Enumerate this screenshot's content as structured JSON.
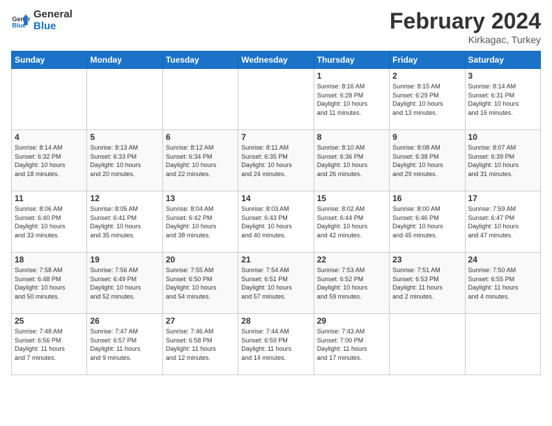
{
  "header": {
    "logo_general": "General",
    "logo_blue": "Blue",
    "month_year": "February 2024",
    "location": "Kirkagac, Turkey"
  },
  "days_of_week": [
    "Sunday",
    "Monday",
    "Tuesday",
    "Wednesday",
    "Thursday",
    "Friday",
    "Saturday"
  ],
  "weeks": [
    [
      {
        "day": "",
        "info": ""
      },
      {
        "day": "",
        "info": ""
      },
      {
        "day": "",
        "info": ""
      },
      {
        "day": "",
        "info": ""
      },
      {
        "day": "1",
        "info": "Sunrise: 8:16 AM\nSunset: 6:28 PM\nDaylight: 10 hours\nand 11 minutes."
      },
      {
        "day": "2",
        "info": "Sunrise: 8:15 AM\nSunset: 6:29 PM\nDaylight: 10 hours\nand 13 minutes."
      },
      {
        "day": "3",
        "info": "Sunrise: 8:14 AM\nSunset: 6:31 PM\nDaylight: 10 hours\nand 16 minutes."
      }
    ],
    [
      {
        "day": "4",
        "info": "Sunrise: 8:14 AM\nSunset: 6:32 PM\nDaylight: 10 hours\nand 18 minutes."
      },
      {
        "day": "5",
        "info": "Sunrise: 8:13 AM\nSunset: 6:33 PM\nDaylight: 10 hours\nand 20 minutes."
      },
      {
        "day": "6",
        "info": "Sunrise: 8:12 AM\nSunset: 6:34 PM\nDaylight: 10 hours\nand 22 minutes."
      },
      {
        "day": "7",
        "info": "Sunrise: 8:11 AM\nSunset: 6:35 PM\nDaylight: 10 hours\nand 24 minutes."
      },
      {
        "day": "8",
        "info": "Sunrise: 8:10 AM\nSunset: 6:36 PM\nDaylight: 10 hours\nand 26 minutes."
      },
      {
        "day": "9",
        "info": "Sunrise: 8:08 AM\nSunset: 6:38 PM\nDaylight: 10 hours\nand 29 minutes."
      },
      {
        "day": "10",
        "info": "Sunrise: 8:07 AM\nSunset: 6:39 PM\nDaylight: 10 hours\nand 31 minutes."
      }
    ],
    [
      {
        "day": "11",
        "info": "Sunrise: 8:06 AM\nSunset: 6:40 PM\nDaylight: 10 hours\nand 33 minutes."
      },
      {
        "day": "12",
        "info": "Sunrise: 8:05 AM\nSunset: 6:41 PM\nDaylight: 10 hours\nand 35 minutes."
      },
      {
        "day": "13",
        "info": "Sunrise: 8:04 AM\nSunset: 6:42 PM\nDaylight: 10 hours\nand 38 minutes."
      },
      {
        "day": "14",
        "info": "Sunrise: 8:03 AM\nSunset: 6:43 PM\nDaylight: 10 hours\nand 40 minutes."
      },
      {
        "day": "15",
        "info": "Sunrise: 8:02 AM\nSunset: 6:44 PM\nDaylight: 10 hours\nand 42 minutes."
      },
      {
        "day": "16",
        "info": "Sunrise: 8:00 AM\nSunset: 6:46 PM\nDaylight: 10 hours\nand 45 minutes."
      },
      {
        "day": "17",
        "info": "Sunrise: 7:59 AM\nSunset: 6:47 PM\nDaylight: 10 hours\nand 47 minutes."
      }
    ],
    [
      {
        "day": "18",
        "info": "Sunrise: 7:58 AM\nSunset: 6:48 PM\nDaylight: 10 hours\nand 50 minutes."
      },
      {
        "day": "19",
        "info": "Sunrise: 7:56 AM\nSunset: 6:49 PM\nDaylight: 10 hours\nand 52 minutes."
      },
      {
        "day": "20",
        "info": "Sunrise: 7:55 AM\nSunset: 6:50 PM\nDaylight: 10 hours\nand 54 minutes."
      },
      {
        "day": "21",
        "info": "Sunrise: 7:54 AM\nSunset: 6:51 PM\nDaylight: 10 hours\nand 57 minutes."
      },
      {
        "day": "22",
        "info": "Sunrise: 7:53 AM\nSunset: 6:52 PM\nDaylight: 10 hours\nand 59 minutes."
      },
      {
        "day": "23",
        "info": "Sunrise: 7:51 AM\nSunset: 6:53 PM\nDaylight: 11 hours\nand 2 minutes."
      },
      {
        "day": "24",
        "info": "Sunrise: 7:50 AM\nSunset: 6:55 PM\nDaylight: 11 hours\nand 4 minutes."
      }
    ],
    [
      {
        "day": "25",
        "info": "Sunrise: 7:48 AM\nSunset: 6:56 PM\nDaylight: 11 hours\nand 7 minutes."
      },
      {
        "day": "26",
        "info": "Sunrise: 7:47 AM\nSunset: 6:57 PM\nDaylight: 11 hours\nand 9 minutes."
      },
      {
        "day": "27",
        "info": "Sunrise: 7:46 AM\nSunset: 6:58 PM\nDaylight: 11 hours\nand 12 minutes."
      },
      {
        "day": "28",
        "info": "Sunrise: 7:44 AM\nSunset: 6:59 PM\nDaylight: 11 hours\nand 14 minutes."
      },
      {
        "day": "29",
        "info": "Sunrise: 7:43 AM\nSunset: 7:00 PM\nDaylight: 11 hours\nand 17 minutes."
      },
      {
        "day": "",
        "info": ""
      },
      {
        "day": "",
        "info": ""
      }
    ]
  ]
}
